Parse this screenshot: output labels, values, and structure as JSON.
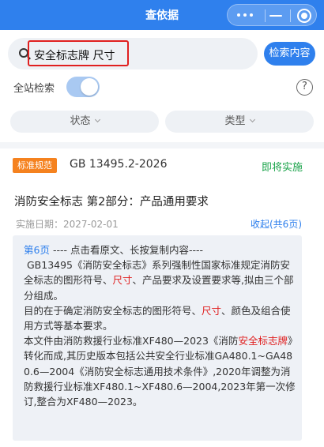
{
  "header": {
    "title": "查依据"
  },
  "search": {
    "query": "安全标志牌 尺寸",
    "button_label": "检索内容"
  },
  "options": {
    "full_site_label": "全站检索",
    "full_site_enabled": true,
    "help_symbol": "?"
  },
  "filters": [
    {
      "label": "状态"
    },
    {
      "label": "类型"
    }
  ],
  "result": {
    "tag": "标准规范",
    "code": "GB 13495.2-2026",
    "status": "即将实施",
    "title": "消防安全标志 第2部分：产品通用要求",
    "impl_date": "实施日期：2027-02-01",
    "collapse_label": "收起(共6页)",
    "page_label": "第6页",
    "excerpt": {
      "line1": "---- 点击看原文、长按复制内容----",
      "p1a": " GB13495《消防安全标志》系列强制性国家标准规定消防安全标志的图形符号、",
      "p1b": "尺寸",
      "p1c": "、产品要求及设置要求等,拟由三个部分组成。",
      "p2a": "目的在于确定消防安全标志的图形符号、",
      "p2b": "尺寸",
      "p2c": "、颜色及组合使用方式等基本要求。",
      "p3a": "本文件由消防救援行业标准XF480—2023《消防",
      "p3b": "安全标志牌",
      "p3c": "》转化而成,其历史版本包括公共安全行业标准GA480.1~GA480.6—2004《消防安全标志通用技术条件》,2020年调整为消防救援行业标准XF480.1~XF480.6—2004,2023年第一次修订,整合为XF480—2023。"
    }
  },
  "colors": {
    "primary": "#2f80ed",
    "tag": "#f5821f",
    "status_green": "#1aa34a",
    "highlight": "#e02020"
  }
}
